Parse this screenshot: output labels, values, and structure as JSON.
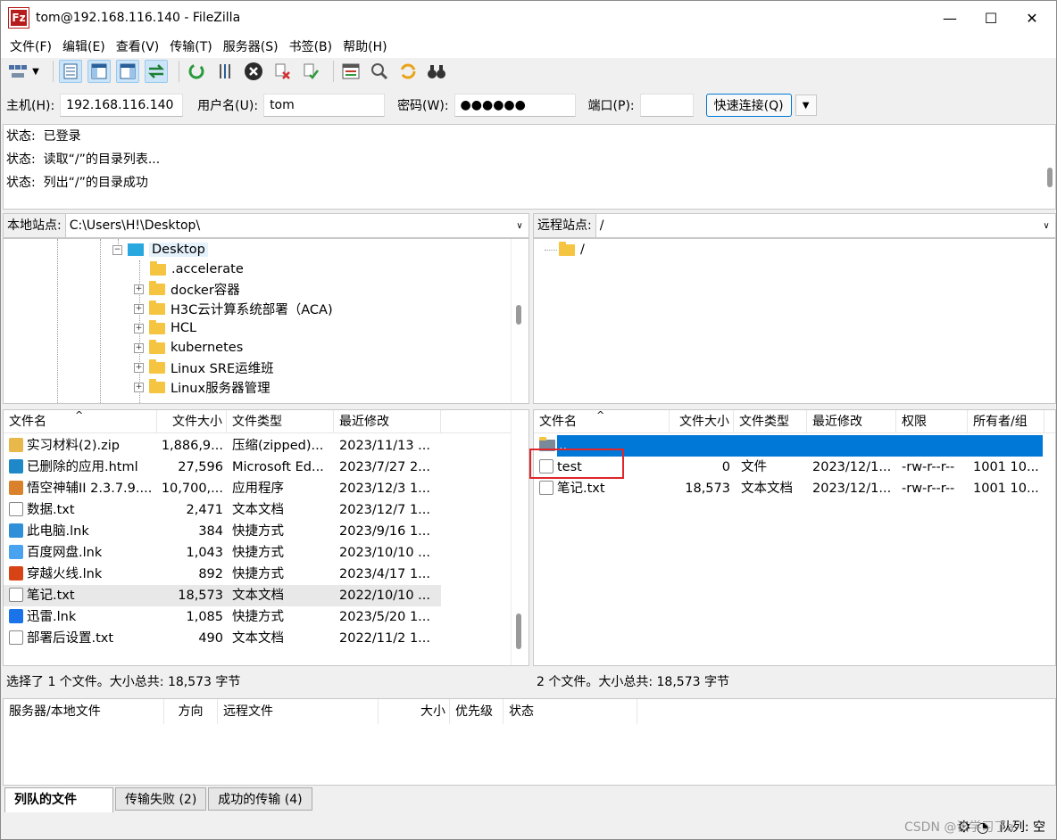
{
  "window": {
    "title": "tom@192.168.116.140 - FileZilla",
    "app_icon_text": "Fz",
    "minimize": "—",
    "maximize": "☐",
    "close": "✕"
  },
  "menu": [
    "文件(F)",
    "编辑(E)",
    "查看(V)",
    "传输(T)",
    "服务器(S)",
    "书签(B)",
    "帮助(H)"
  ],
  "toolbar": {
    "icons": [
      "site-manager-icon",
      "dropdown-icon",
      "toggle-log-icon",
      "toggle-local-tree-icon",
      "toggle-remote-tree-icon",
      "toggle-queue-icon",
      "refresh-icon",
      "process-queue-icon",
      "cancel-icon",
      "disconnect-icon",
      "reconnect-icon",
      "filter-icon",
      "compare-icon",
      "sync-browse-icon",
      "search-icon"
    ]
  },
  "quickconnect": {
    "host_label": "主机(H):",
    "host": "192.168.116.140",
    "user_label": "用户名(U):",
    "user": "tom",
    "pass_label": "密码(W):",
    "pass": "●●●●●●",
    "port_label": "端口(P):",
    "port": "",
    "button": "快速连接(Q)",
    "dropdown": "▼"
  },
  "log": [
    {
      "label": "状态:",
      "text": "已登录"
    },
    {
      "label": "状态:",
      "text": "读取“/”的目录列表..."
    },
    {
      "label": "状态:",
      "text": "列出“/”的目录成功"
    }
  ],
  "local": {
    "site_label": "本地站点:",
    "path": "C:\\Users\\H!\\Desktop\\",
    "tree": [
      {
        "name": "Desktop",
        "expand": "−",
        "selected": true
      },
      {
        "name": ".accelerate",
        "expand": ""
      },
      {
        "name": "docker容器",
        "expand": "+"
      },
      {
        "name": "H3C云计算系统部署（ACA)",
        "expand": "+"
      },
      {
        "name": "HCL",
        "expand": "+"
      },
      {
        "name": "kubernetes",
        "expand": "+"
      },
      {
        "name": "Linux SRE运维班",
        "expand": "+"
      },
      {
        "name": "Linux服务器管理",
        "expand": "+"
      }
    ],
    "columns": [
      "文件名",
      "文件大小",
      "文件类型",
      "最近修改"
    ],
    "sort_arrow": "^",
    "files": [
      {
        "name": "实习材料(2).zip",
        "size": "1,886,9...",
        "type": "压缩(zipped)...",
        "date": "2023/11/13 ...",
        "icon": "zip-icon",
        "color": "#e8b84a"
      },
      {
        "name": "已删除的应用.html",
        "size": "27,596",
        "type": "Microsoft Ed...",
        "date": "2023/7/27 2...",
        "icon": "edge-icon",
        "color": "#1e88c8"
      },
      {
        "name": "悟空神辅II 2.3.7.9....",
        "size": "10,700,...",
        "type": "应用程序",
        "date": "2023/12/3 1...",
        "icon": "app-icon",
        "color": "#d9822b"
      },
      {
        "name": "数据.txt",
        "size": "2,471",
        "type": "文本文档",
        "date": "2023/12/7 1...",
        "icon": "text-file-icon",
        "color": "#ffffff"
      },
      {
        "name": "此电脑.lnk",
        "size": "384",
        "type": "快捷方式",
        "date": "2023/9/16 1...",
        "icon": "computer-icon",
        "color": "#2f8fd8"
      },
      {
        "name": "百度网盘.lnk",
        "size": "1,043",
        "type": "快捷方式",
        "date": "2023/10/10 ...",
        "icon": "baidu-icon",
        "color": "#4aa3f0"
      },
      {
        "name": "穿越火线.lnk",
        "size": "892",
        "type": "快捷方式",
        "date": "2023/4/17 1...",
        "icon": "game-icon",
        "color": "#d84315"
      },
      {
        "name": "笔记.txt",
        "size": "18,573",
        "type": "文本文档",
        "date": "2022/10/10 ...",
        "icon": "text-file-icon",
        "color": "#ffffff",
        "selected": true
      },
      {
        "name": "迅雷.lnk",
        "size": "1,085",
        "type": "快捷方式",
        "date": "2023/5/20 1...",
        "icon": "thunder-icon",
        "color": "#1a73e8"
      },
      {
        "name": "部署后设置.txt",
        "size": "490",
        "type": "文本文档",
        "date": "2022/11/2 1...",
        "icon": "text-file-icon",
        "color": "#ffffff"
      }
    ],
    "status": "选择了 1 个文件。大小总共: 18,573 字节"
  },
  "remote": {
    "site_label": "远程站点:",
    "path": "/",
    "tree": [
      {
        "name": "/"
      }
    ],
    "columns": [
      "文件名",
      "文件大小",
      "文件类型",
      "最近修改",
      "权限",
      "所有者/组"
    ],
    "sort_arrow": "^",
    "parent_row": "..",
    "files": [
      {
        "name": "test",
        "size": "0",
        "type": "文件",
        "date": "2023/12/1...",
        "perm": "-rw-r--r--",
        "owner": "1001 10..."
      },
      {
        "name": "笔记.txt",
        "size": "18,573",
        "type": "文本文档",
        "date": "2023/12/1...",
        "perm": "-rw-r--r--",
        "owner": "1001 10..."
      }
    ],
    "status": "2 个文件。大小总共: 18,573 字节"
  },
  "queue": {
    "columns": [
      "服务器/本地文件",
      "方向",
      "远程文件",
      "大小",
      "优先级",
      "状态"
    ]
  },
  "tabs": [
    "列队的文件",
    "传输失败 (2)",
    "成功的传输 (4)"
  ],
  "bottom": {
    "queue_label": "队列: 空",
    "watermark": "CSDN @该学习了a"
  }
}
